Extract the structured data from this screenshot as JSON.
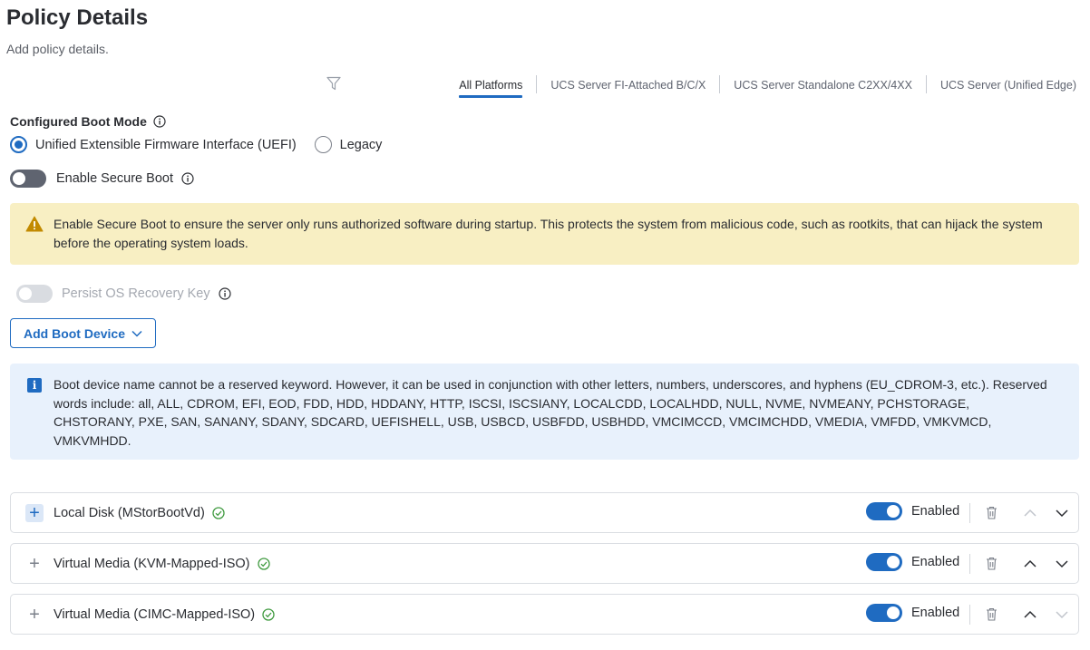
{
  "page": {
    "title": "Policy Details",
    "subtitle": "Add policy details."
  },
  "platforms": {
    "filter_icon": "filter-icon",
    "tabs": [
      {
        "label": "All Platforms",
        "active": true
      },
      {
        "label": "UCS Server FI-Attached B/C/X",
        "active": false
      },
      {
        "label": "UCS Server Standalone C2XX/4XX",
        "active": false
      },
      {
        "label": "UCS Server (Unified Edge)",
        "active": false
      }
    ]
  },
  "boot_mode": {
    "label": "Configured Boot Mode",
    "options": [
      {
        "label": "Unified Extensible Firmware Interface (UEFI)",
        "selected": true
      },
      {
        "label": "Legacy",
        "selected": false
      }
    ]
  },
  "secure_boot": {
    "label": "Enable Secure Boot",
    "enabled": false
  },
  "warning": {
    "text": "Enable Secure Boot to ensure the server only runs authorized software during startup. This protects the system from malicious code, such as rootkits, that can hijack the system before the operating system loads."
  },
  "persist_key": {
    "label": "Persist OS Recovery Key",
    "enabled": false,
    "disabled": true
  },
  "add_boot_device": {
    "label": "Add Boot Device"
  },
  "info": {
    "text": "Boot device name cannot be a reserved keyword. However, it can be used in conjunction with other letters, numbers, underscores, and hyphens (EU_CDROM-3, etc.). Reserved words include: all, ALL, CDROM, EFI, EOD, FDD, HDD, HDDANY, HTTP, ISCSI, ISCSIANY, LOCALCDD, LOCALHDD, NULL, NVME, NVMEANY, PCHSTORAGE, CHSTORANY, PXE, SAN, SANANY, SDANY, SDCARD, UEFISHELL, USB, USBCD, USBFDD, USBHDD, VMCIMCCD, VMCIMCHDD, VMEDIA, VMFDD, VMKVMCD, VMKVMHDD."
  },
  "devices": [
    {
      "name": "Local Disk (MStorBootVd)",
      "status_label": "Enabled",
      "enabled": true,
      "up_enabled": false,
      "down_enabled": true
    },
    {
      "name": "Virtual Media (KVM-Mapped-ISO)",
      "status_label": "Enabled",
      "enabled": true,
      "up_enabled": true,
      "down_enabled": true
    },
    {
      "name": "Virtual Media (CIMC-Mapped-ISO)",
      "status_label": "Enabled",
      "enabled": true,
      "up_enabled": true,
      "down_enabled": false
    }
  ],
  "colors": {
    "accent": "#1f6bc1",
    "warning_bg": "#f8efc3",
    "info_bg": "#e8f1fc",
    "success": "#3f9a3f"
  }
}
